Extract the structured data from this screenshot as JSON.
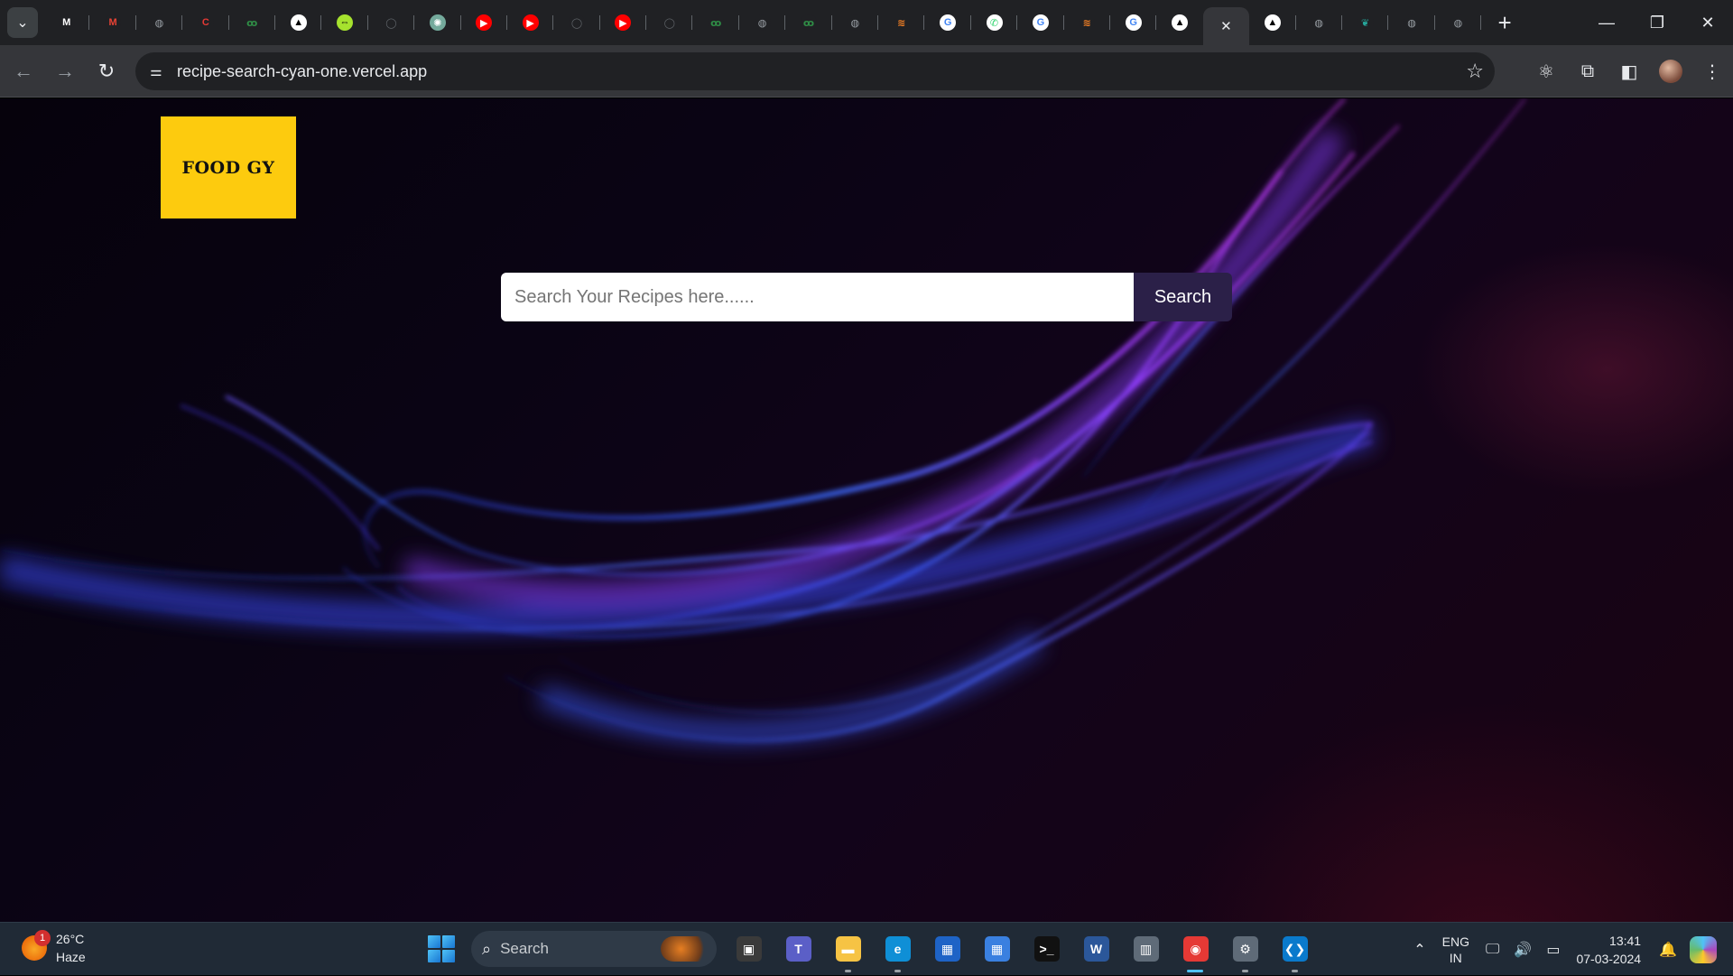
{
  "browser": {
    "tabs": [
      {
        "icon": "medium-icon",
        "glyph": "M",
        "color": "#ffffff",
        "bg": "#202124"
      },
      {
        "icon": "gmail-icon",
        "glyph": "M",
        "color": "#ea4335",
        "bg": "#202124"
      },
      {
        "icon": "globe-icon",
        "glyph": "◍",
        "color": "#9aa0a6",
        "bg": "#202124"
      },
      {
        "icon": "c-red-icon",
        "glyph": "C",
        "color": "#e53935",
        "bg": "#202124"
      },
      {
        "icon": "geeksforgeeks-icon",
        "glyph": "ꝏ",
        "color": "#2f8d46",
        "bg": "#202124"
      },
      {
        "icon": "vercel-icon",
        "glyph": "▲",
        "color": "#000000",
        "bg": "#ffffff"
      },
      {
        "icon": "teamviewer-icon",
        "glyph": "⇔",
        "color": "#000000",
        "bg": "#a6e22e"
      },
      {
        "icon": "github-icon",
        "glyph": "◯",
        "color": "#5f6368",
        "bg": "#202124"
      },
      {
        "icon": "chatgpt-icon",
        "glyph": "✺",
        "color": "#ffffff",
        "bg": "#74aa9c"
      },
      {
        "icon": "youtube-icon",
        "glyph": "▶",
        "color": "#ffffff",
        "bg": "#ff0000"
      },
      {
        "icon": "youtube-icon",
        "glyph": "▶",
        "color": "#ffffff",
        "bg": "#ff0000"
      },
      {
        "icon": "github-icon",
        "glyph": "◯",
        "color": "#5f6368",
        "bg": "#202124"
      },
      {
        "icon": "youtube-icon",
        "glyph": "▶",
        "color": "#ffffff",
        "bg": "#ff0000"
      },
      {
        "icon": "github-icon",
        "glyph": "◯",
        "color": "#5f6368",
        "bg": "#202124"
      },
      {
        "icon": "geeksforgeeks-icon",
        "glyph": "ꝏ",
        "color": "#2f8d46",
        "bg": "#202124"
      },
      {
        "icon": "globe-icon",
        "glyph": "◍",
        "color": "#9aa0a6",
        "bg": "#202124"
      },
      {
        "icon": "geeksforgeeks-icon",
        "glyph": "ꝏ",
        "color": "#2f8d46",
        "bg": "#202124"
      },
      {
        "icon": "globe-icon",
        "glyph": "◍",
        "color": "#9aa0a6",
        "bg": "#202124"
      },
      {
        "icon": "stackoverflow-icon",
        "glyph": "≋",
        "color": "#f48024",
        "bg": "#202124"
      },
      {
        "icon": "google-icon",
        "glyph": "G",
        "color": "#4285f4",
        "bg": "#ffffff"
      },
      {
        "icon": "whatsapp-icon",
        "glyph": "✆",
        "color": "#25d366",
        "bg": "#ffffff"
      },
      {
        "icon": "google-icon",
        "glyph": "G",
        "color": "#4285f4",
        "bg": "#ffffff"
      },
      {
        "icon": "stackoverflow-icon",
        "glyph": "≋",
        "color": "#f48024",
        "bg": "#202124"
      },
      {
        "icon": "google-icon",
        "glyph": "G",
        "color": "#4285f4",
        "bg": "#ffffff"
      },
      {
        "icon": "vercel-icon",
        "glyph": "▲",
        "color": "#000000",
        "bg": "#ffffff"
      },
      {
        "icon": "close-icon",
        "glyph": "✕",
        "color": "#e8eaed",
        "bg": "transparent",
        "active": true
      },
      {
        "icon": "vercel-icon",
        "glyph": "▲",
        "color": "#000000",
        "bg": "#ffffff"
      },
      {
        "icon": "globe-icon",
        "glyph": "◍",
        "color": "#9aa0a6",
        "bg": "#202124"
      },
      {
        "icon": "feather-icon",
        "glyph": "❦",
        "color": "#26a69a",
        "bg": "#202124"
      },
      {
        "icon": "globe-icon",
        "glyph": "◍",
        "color": "#9aa0a6",
        "bg": "#202124"
      },
      {
        "icon": "globe-icon",
        "glyph": "◍",
        "color": "#9aa0a6",
        "bg": "#202124"
      }
    ],
    "url": "recipe-search-cyan-one.vercel.app"
  },
  "page": {
    "logo_text": "FOOD GY",
    "search": {
      "placeholder": "Search Your Recipes here......",
      "value": "",
      "button_label": "Search"
    }
  },
  "taskbar": {
    "weather": {
      "badge": "1",
      "temp": "26°C",
      "condition": "Haze"
    },
    "search_label": "Search",
    "apps": [
      {
        "icon": "task-view-icon",
        "glyph": "▣",
        "bg": "#3a3a3a"
      },
      {
        "icon": "teams-icon",
        "glyph": "T",
        "bg": "#5b5fc7"
      },
      {
        "icon": "file-explorer-icon",
        "glyph": "▬",
        "bg": "#f6c344",
        "running": true
      },
      {
        "icon": "edge-icon",
        "glyph": "e",
        "bg": "#0f8fd6",
        "running": true
      },
      {
        "icon": "store-icon",
        "glyph": "▦",
        "bg": "#1e63c6"
      },
      {
        "icon": "calendar-icon",
        "glyph": "▦",
        "bg": "#3a80e0"
      },
      {
        "icon": "terminal-icon",
        "glyph": ">_",
        "bg": "#111111"
      },
      {
        "icon": "word-icon",
        "glyph": "W",
        "bg": "#2b579a"
      },
      {
        "icon": "calculator-icon",
        "glyph": "▥",
        "bg": "#5f6b78"
      },
      {
        "icon": "chrome-icon",
        "glyph": "◉",
        "bg": "#e53935",
        "active": true
      },
      {
        "icon": "settings-icon",
        "glyph": "⚙",
        "bg": "#5f6b78",
        "running": true
      },
      {
        "icon": "vscode-icon",
        "glyph": "❮❯",
        "bg": "#0a7acc",
        "running": true
      }
    ],
    "lang": {
      "line1": "ENG",
      "line2": "IN"
    },
    "time": "13:41",
    "date": "07-03-2024"
  }
}
